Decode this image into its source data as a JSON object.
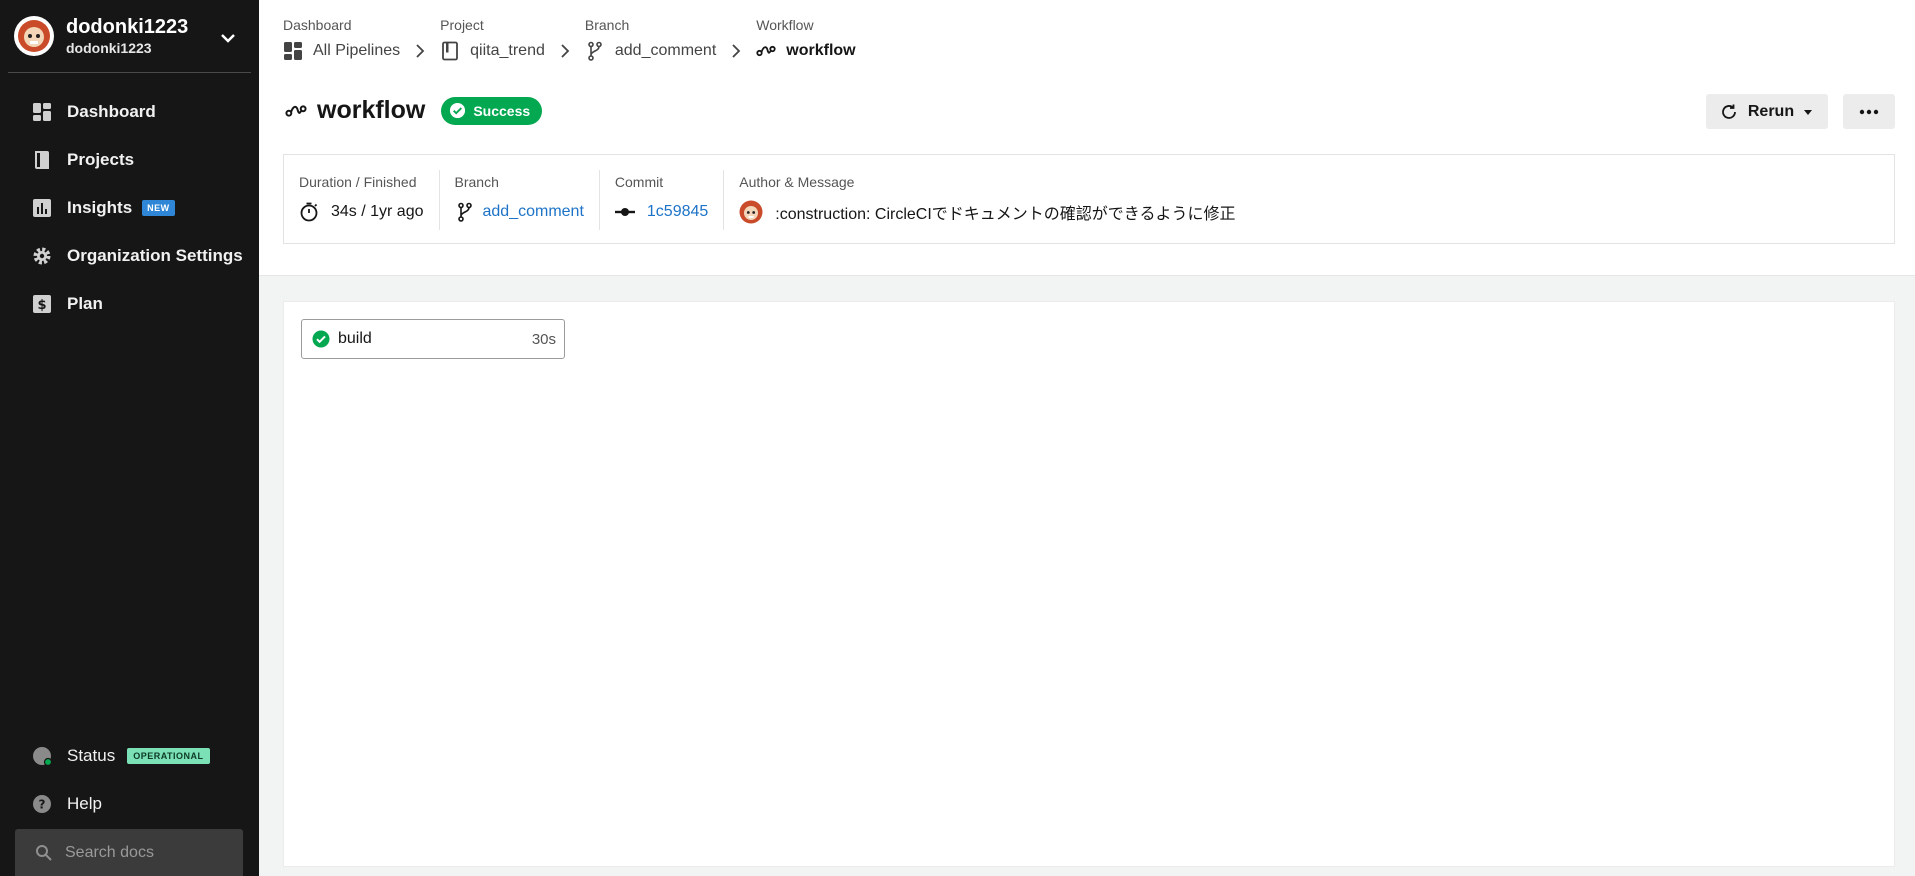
{
  "org": {
    "name": "dodonki1223",
    "sub": "dodonki1223"
  },
  "nav": {
    "dashboard": "Dashboard",
    "projects": "Projects",
    "insights": "Insights",
    "insights_badge": "NEW",
    "org_settings": "Organization Settings",
    "plan": "Plan",
    "status": "Status",
    "status_badge": "OPERATIONAL",
    "help": "Help",
    "search_placeholder": "Search docs"
  },
  "breadcrumbs": [
    {
      "label": "Dashboard",
      "value": "All Pipelines",
      "icon": "dashboard-icon"
    },
    {
      "label": "Project",
      "value": "qiita_trend",
      "icon": "project-icon"
    },
    {
      "label": "Branch",
      "value": "add_comment",
      "icon": "branch-icon"
    },
    {
      "label": "Workflow",
      "value": "workflow",
      "icon": "workflow-icon"
    }
  ],
  "header": {
    "title": "workflow",
    "status": "Success",
    "rerun_label": "Rerun",
    "more_icon": "ellipsis-icon"
  },
  "meta": {
    "duration_label": "Duration / Finished",
    "duration_value": "34s / 1yr ago",
    "branch_label": "Branch",
    "branch_value": "add_comment",
    "commit_label": "Commit",
    "commit_value": "1c59845",
    "author_label": "Author & Message",
    "message": ":construction: CircleCIでドキュメントの確認ができるように修正"
  },
  "jobs": [
    {
      "name": "build",
      "duration": "30s",
      "status": "success"
    }
  ],
  "colors": {
    "sidebar": "#161616",
    "success": "#04a851",
    "link": "#1d73c8",
    "new_badge": "#2f86d6",
    "operational_badge": "#7be0b5"
  }
}
